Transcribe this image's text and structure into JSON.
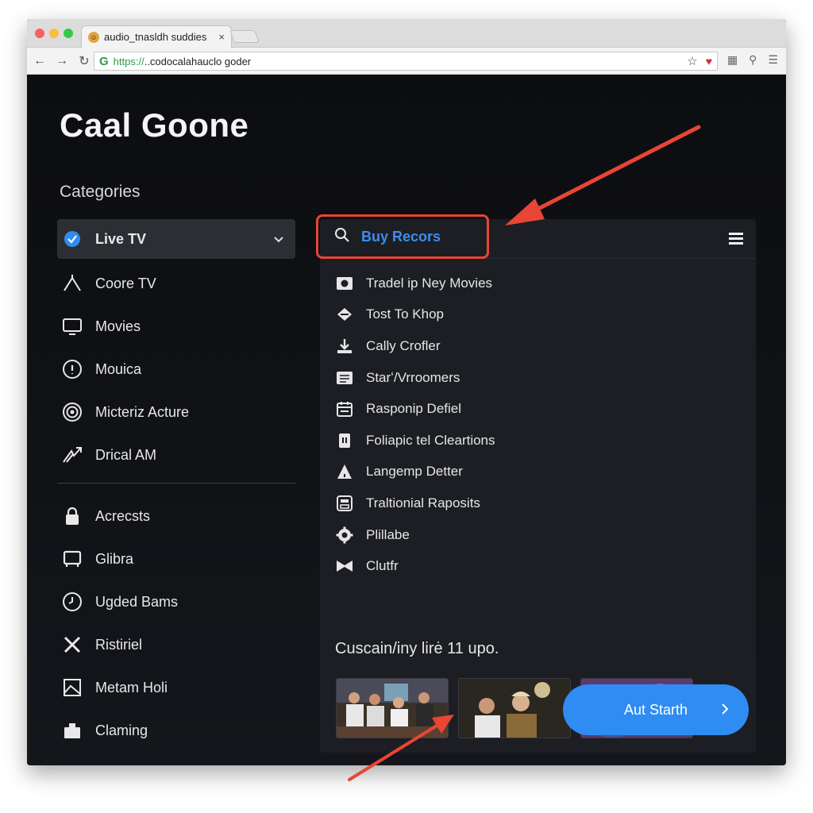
{
  "browser": {
    "tab_title": "audio_tnasldh suddies",
    "tab_close": "×",
    "url_scheme": "https://",
    "url_rest": "..codocalahauclo goder"
  },
  "page": {
    "title": "Caal Goone",
    "categories_label": "Categories"
  },
  "sidebar": {
    "items": [
      {
        "label": "Live TV",
        "icon": "check-circle-icon",
        "active": true
      },
      {
        "label": "Coore TV",
        "icon": "antenna-icon"
      },
      {
        "label": "Movies",
        "icon": "monitor-icon"
      },
      {
        "label": "Mouica",
        "icon": "info-circle-icon"
      },
      {
        "label": "Micteriz Acture",
        "icon": "target-icon"
      },
      {
        "label": "Drical AM",
        "icon": "trend-icon"
      }
    ],
    "items2": [
      {
        "label": "Acrecsts",
        "icon": "lock-icon"
      },
      {
        "label": "Glibra",
        "icon": "tv-icon"
      },
      {
        "label": "Ugded Bams",
        "icon": "clock-icon"
      },
      {
        "label": "Ristiriel",
        "icon": "tools-icon"
      },
      {
        "label": "Metam Holi",
        "icon": "image-icon"
      },
      {
        "label": "Claming",
        "icon": "bag-icon"
      }
    ]
  },
  "panel": {
    "search_text": "Buy Recors",
    "items": [
      {
        "label": "Tradel ip Ney Movies",
        "icon": "camera-icon"
      },
      {
        "label": "Tost To Khop",
        "icon": "diamond-icon"
      },
      {
        "label": "Cally Crofler",
        "icon": "download-icon"
      },
      {
        "label": "Starʻ/Vrroomers",
        "icon": "list-icon"
      },
      {
        "label": "Rasponip Defiel",
        "icon": "calendar-icon"
      },
      {
        "label": "Foliapic tel Cleartions",
        "icon": "book-icon"
      },
      {
        "label": "Langemp Detter",
        "icon": "triangle-icon"
      },
      {
        "label": "Traltionial Raposits",
        "icon": "save-icon"
      },
      {
        "label": "Plillabe",
        "icon": "gear-icon"
      },
      {
        "label": "Clutfr",
        "icon": "bowtie-icon"
      }
    ],
    "section_title": "Cuscain/iny lirė 11 upo.",
    "cta_label": "Aut Starth"
  },
  "colors": {
    "accent": "#2f8cf2",
    "highlight": "#e84535",
    "background": "#0f1115",
    "panel": "#1c1e23"
  }
}
